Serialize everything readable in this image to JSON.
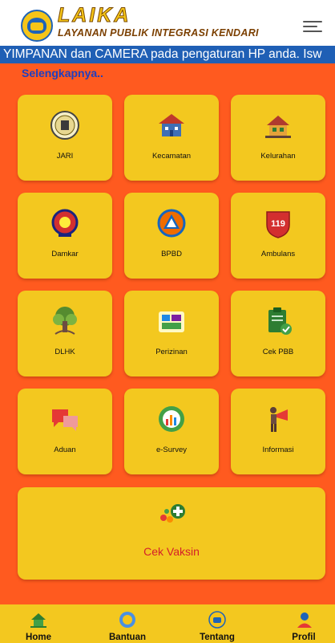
{
  "header": {
    "app_name": "LAIKA",
    "app_subtitle": "LAYANAN PUBLIK INTEGRASI KENDARI"
  },
  "announcement": {
    "text": "YIMPANAN dan CAMERA pada pengaturan HP anda.   Isw",
    "more_link": "Selengkapnya.."
  },
  "services": [
    {
      "label": "JARI",
      "icon": "jari-emblem-icon"
    },
    {
      "label": "Kecamatan",
      "icon": "building-icon"
    },
    {
      "label": "Kelurahan",
      "icon": "house-icon"
    },
    {
      "label": "Damkar",
      "icon": "damkar-emblem-icon"
    },
    {
      "label": "BPBD",
      "icon": "bpbd-emblem-icon"
    },
    {
      "label": "Ambulans",
      "icon": "ambulance-119-icon"
    },
    {
      "label": "DLHK",
      "icon": "tree-icon"
    },
    {
      "label": "Perizinan",
      "icon": "dpmptsp-logo-icon"
    },
    {
      "label": "Cek PBB",
      "icon": "clipboard-check-icon"
    },
    {
      "label": "Aduan",
      "icon": "chat-bubbles-icon"
    },
    {
      "label": "e-Survey",
      "icon": "survey-chart-icon"
    },
    {
      "label": "Informasi",
      "icon": "megaphone-icon"
    }
  ],
  "vaccine": {
    "label": "Cek Vaksin",
    "icon": "vaccine-icon"
  },
  "bottom_nav": [
    {
      "label": "Home",
      "icon": "home-icon"
    },
    {
      "label": "Bantuan",
      "icon": "help-icon"
    },
    {
      "label": "Tentang",
      "icon": "about-logo-icon"
    },
    {
      "label": "Profil",
      "icon": "profile-icon"
    }
  ],
  "colors": {
    "main_background": "#ff5a1f",
    "tile": "#f3c81f",
    "marquee": "#1f5fb5",
    "vaccine_label": "#d4202a"
  }
}
